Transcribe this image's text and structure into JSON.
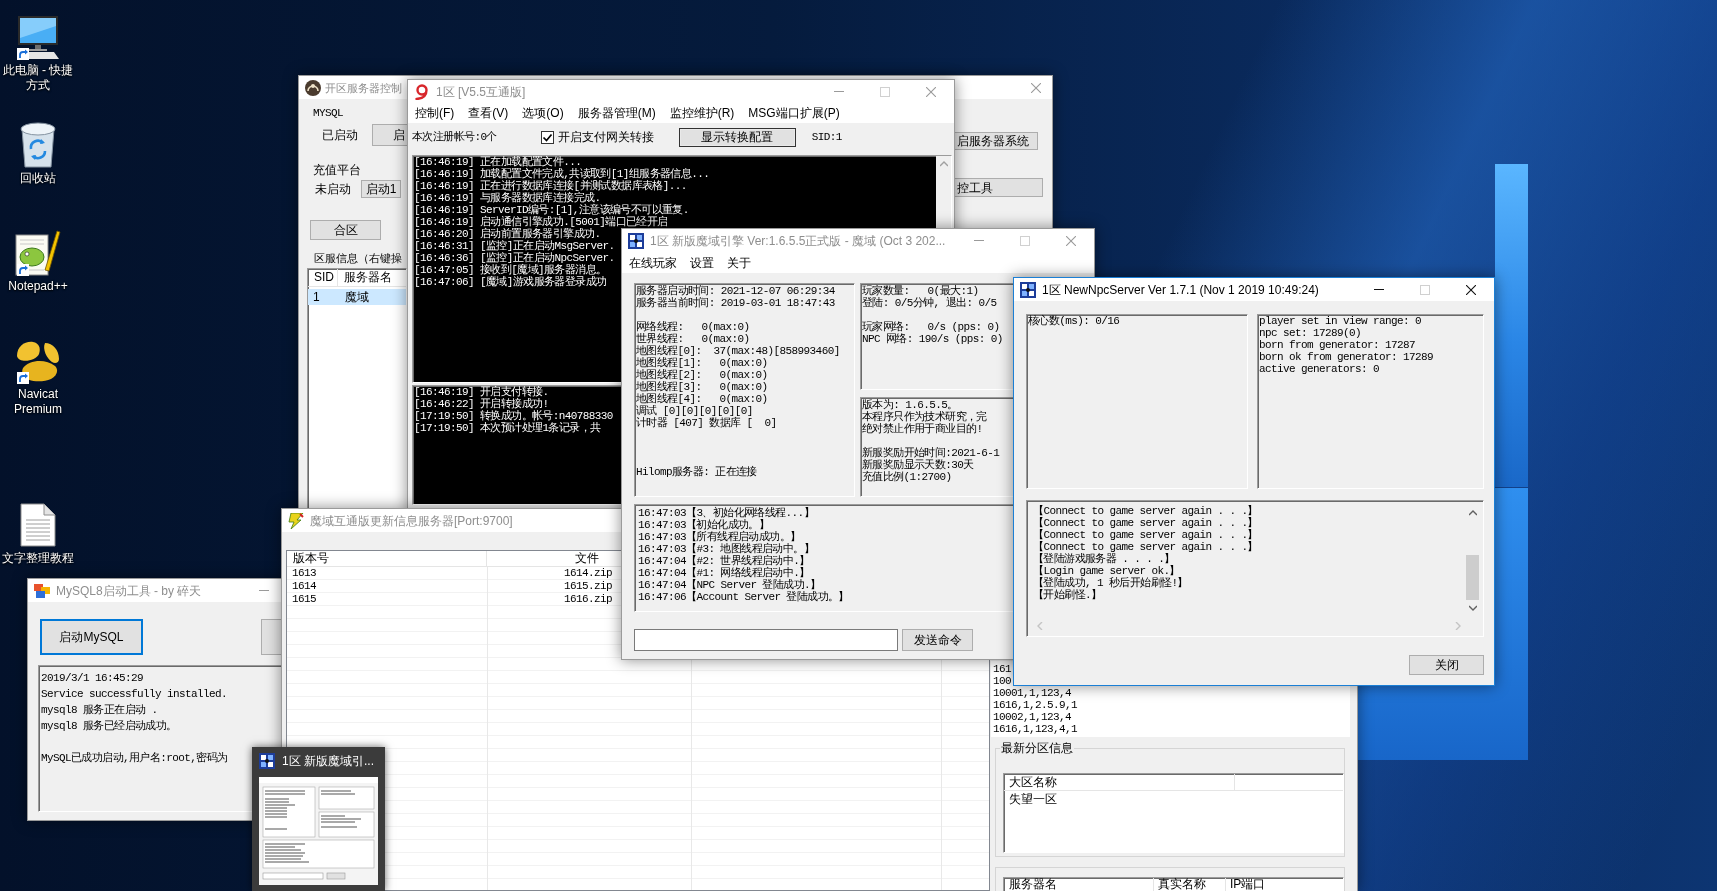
{
  "desktop_icons": [
    {
      "label": "此电脑 - 快捷方式",
      "kind": "computer",
      "shortcut": true
    },
    {
      "label": "回收站",
      "kind": "recycle-bin",
      "shortcut": false
    },
    {
      "label": "Notepad++",
      "kind": "notepad",
      "shortcut": true
    },
    {
      "label": "Navicat Premium",
      "kind": "database-app",
      "shortcut": true
    },
    {
      "label": "文字整理教程",
      "kind": "document",
      "shortcut": false
    }
  ],
  "server_control_window": {
    "title": "开区服务器控制",
    "active": false,
    "title_buttons": [
      {
        "kind": "close",
        "disabled": false
      }
    ],
    "mysql": {
      "label": "MYSQL",
      "status": "已启动",
      "button": "启"
    },
    "recharge": {
      "label": "充值平台",
      "status": "未启动",
      "button": "启动1"
    },
    "merge_button": "合区",
    "server_list": {
      "label": "区服信息（右键操",
      "columns": [
        "SID",
        "服务器名"
      ],
      "rows": [
        {
          "cells": [
            "1",
            "魔域"
          ],
          "selected": true
        }
      ]
    },
    "side_buttons": [
      "启服务器系统",
      "控工具"
    ]
  },
  "console_window": {
    "title": "1区 [V5.5互通版]",
    "active": false,
    "title_buttons": [
      {
        "kind": "minimize",
        "disabled": false
      },
      {
        "kind": "maximize",
        "disabled": true
      },
      {
        "kind": "close",
        "disabled": false
      }
    ],
    "menu": [
      "控制(F)",
      "查看(V)",
      "选项(O)",
      "服务器管理(M)",
      "监控维护(R)",
      "MSG端口扩展(P)"
    ],
    "register_count": "本次注册帐号:0个",
    "gateway_option": {
      "label": "开启支付网关转接",
      "checked": true
    },
    "config_button": "显示转换配置",
    "sid": "SID:1",
    "log": [
      "[16:46:19] 正在加载配置文件...",
      "[16:46:19] 加载配置文件完成,共读取到[1]组服务器信息...",
      "[16:46:19] 正在进行数据库连接[并测试数据库表格]...",
      "[16:46:19] 与服务器数据库连接完成.",
      "[16:46:19] ServerID编号:[1],注意该编号不可以重复.",
      "[16:46:19] 启动通信引擎成功.[5001]端口已经开启",
      "[16:46:20] 启动前置服务器引擎成功.",
      "[16:46:31] [监控]正在启动MsgServer.",
      "[16:46:36] [监控]正在启动NpcServer.",
      "[16:47:05] 接收到[魔域]服务器消息。",
      "[16:47:06] [魔域]游戏服务器登录成功"
    ],
    "transfer_log": [
      "[16:46:19] 开启支付转接.",
      "[16:46:22] 开启转接成功!",
      "[17:19:50] 转换成功。帐号:n40788330",
      "[17:19:50] 本次预计处理1条记录，共"
    ]
  },
  "engine_window": {
    "title": "1区 新版魔域引擎 Ver:1.6.5.5正式版 - 魔域 (Oct 3 202...",
    "active": false,
    "title_buttons": [
      {
        "kind": "minimize",
        "disabled": false
      },
      {
        "kind": "maximize",
        "disabled": true
      },
      {
        "kind": "close",
        "disabled": false
      }
    ],
    "menu": [
      "在线玩家",
      "设置",
      "关于"
    ],
    "status_blocks": [
      {
        "lines": [
          "服务器启动时间: 2021-12-07 06:29:34",
          "服务器当前时间: 2019-03-01 18:47:43"
        ]
      },
      {
        "lines": [
          "网络线程:   0(max:0)",
          "世界线程:   0(max:0)",
          "地图线程[0]:  37(max:48)[858993460]",
          "地图线程[1]:   0(max:0)",
          "地图线程[2]:   0(max:0)",
          "地图线程[3]:   0(max:0)",
          "地图线程[4]:   0(max:0)",
          "调试 [0][0][0][0][0]",
          "计时器 [407] 数据库 [  0]"
        ]
      },
      {
        "lines": [
          "Hilomp服务器: 正在连接"
        ]
      }
    ],
    "network_blocks": [
      {
        "lines": [
          "玩家数量:   0(最大:1)",
          "登陆: 0/5分钟, 退出: 0/5"
        ]
      },
      {
        "lines": [
          "玩家网络:   0/s (pps: 0)",
          "NPC 网络: 190/s (pps: 0)"
        ]
      }
    ],
    "about_blocks": [
      {
        "lines": [
          "版本为: 1.6.5.5。",
          "本程序只作为技术研究，完",
          "绝对禁止作用于商业目的!"
        ]
      },
      {
        "lines": [
          "新服奖励开始时间:2021-6-1",
          "新服奖励显示天数:30天",
          "充值比例(1:2700)"
        ]
      }
    ],
    "log": [
      "16:47:03【3、初始化网络线程...】",
      "16:47:03【初始化成功。】",
      "16:47:03【所有线程启动成功。】",
      "16:47:03【#3: 地图线程启动中。】",
      "16:47:04【#2: 世界线程启动中.】",
      "16:47:04【#1: 网络线程启动中.】",
      "16:47:04【NPC Server 登陆成功.】",
      "16:47:06【Account Server 登陆成功。】"
    ],
    "command_button": "发送命令"
  },
  "npc_window": {
    "title": "1区 NewNpcServer Ver 1.7.1 (Nov 1 2019 10:49:24)",
    "active": true,
    "title_buttons": [
      {
        "kind": "minimize",
        "disabled": false
      },
      {
        "kind": "maximize",
        "disabled": true
      },
      {
        "kind": "close",
        "disabled": false
      }
    ],
    "core_usage": "核心数(ms): 0/16",
    "generator_stats": [
      "player set in view range: 0",
      "npc set: 17289(0)",
      "born from generator: 17287",
      "born ok from generator: 17289",
      "active generators: 0"
    ],
    "log": [
      "【Connect to game server again . . .】",
      "【Connect to game server again . . .】",
      "【Connect to game server again . . .】",
      "【Connect to game server again . . .】",
      "【登陆游戏服务器 . . . .】",
      "【Login game server ok.】",
      "【登陆成功, 1 秒后开始刷怪!】",
      "【开始刷怪.】"
    ],
    "close_button": "关闭"
  },
  "update_window": {
    "title": "魔域互通版更新信息服务器[Port:9700]",
    "active": false,
    "table": {
      "columns": [
        "版本号",
        "文件"
      ],
      "rows": [
        {
          "cells": [
            "1613",
            "1614.zip"
          ]
        },
        {
          "cells": [
            "1614",
            "1615.zip"
          ]
        },
        {
          "cells": [
            "1615",
            "1616.zip"
          ]
        }
      ]
    },
    "records": [
      "161",
      "100",
      "10001,1,123,4",
      "1616,1,2.5.9,1",
      "10002,1,123,4",
      "1616,1,123,4,1"
    ],
    "zone_group": {
      "title": "最新分区信息",
      "columns": [
        "大区名称"
      ],
      "rows": [
        {
          "cells": [
            "失望一区"
          ]
        }
      ]
    },
    "server_table": {
      "columns": [
        "服务器名",
        "真实名称",
        "IP端口"
      ]
    }
  },
  "mysql_window": {
    "title": "MySQL8启动工具 - by 碎天",
    "active": false,
    "title_buttons": [
      {
        "kind": "minimize",
        "disabled": false
      }
    ],
    "start_button": {
      "label": "启动MySQL",
      "focused": true
    },
    "log_blocks": [
      {
        "lines": [
          "2019/3/1 16:45:29",
          "Service successfully installed.",
          "mysql8 服务正在启动 .",
          "mysql8 服务已经启动成功。"
        ]
      },
      {
        "lines": [
          "MySQL已成功启动,用户名:root,密码为"
        ]
      }
    ]
  },
  "taskbar_preview": {
    "title": "1区 新版魔域引..."
  }
}
